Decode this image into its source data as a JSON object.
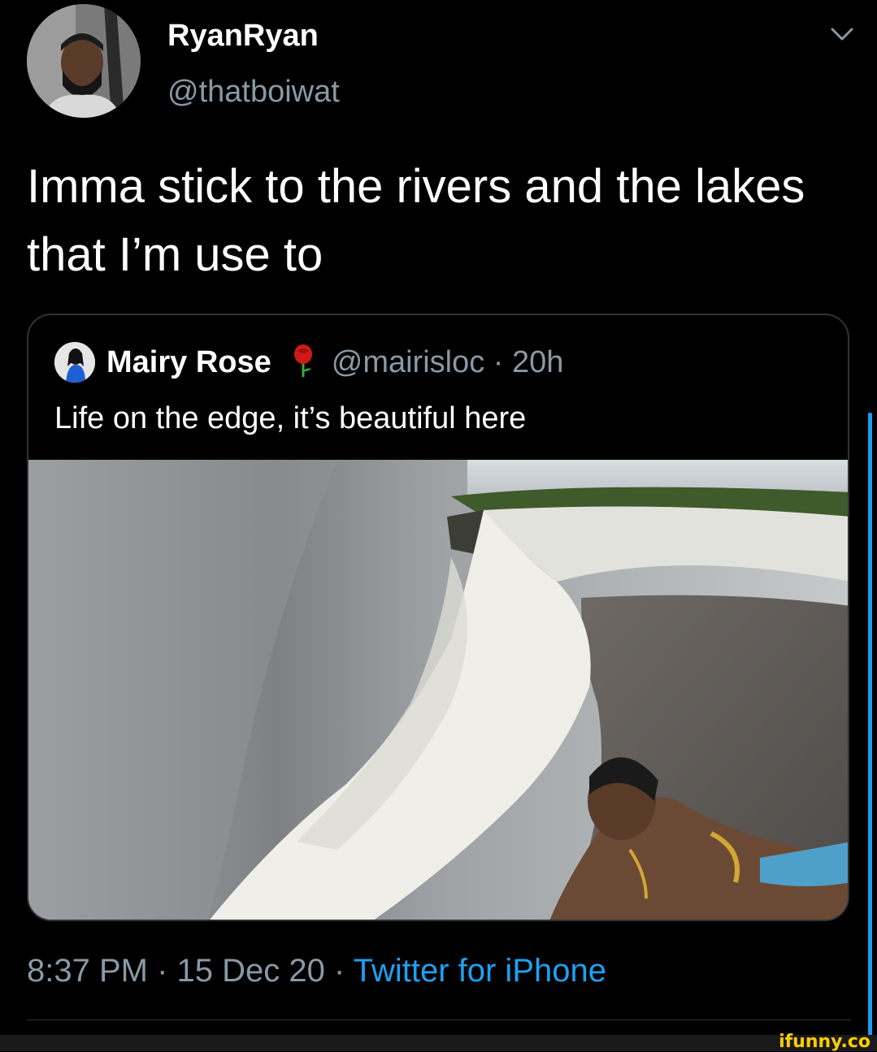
{
  "tweet": {
    "author": {
      "display_name": "RyanRyan",
      "handle": "@thatboiwat",
      "avatar_icon": "person-avatar"
    },
    "menu_icon": "chevron-down-icon",
    "text": "Imma stick to the rivers and the lakes that I’m use to",
    "quoted_tweet": {
      "author": {
        "display_name": "Mairy Rose",
        "name_emoji": "rose-icon",
        "handle": "@mairisloc",
        "separator": "·",
        "time": "20h",
        "avatar_icon": "person-avatar"
      },
      "text": "Life on the edge, it’s beautiful here",
      "media": "waterfall-photo"
    },
    "meta": {
      "time": "8:37 PM",
      "sep1": "·",
      "date": "15 Dec 20",
      "sep2": "·",
      "source": "Twitter for iPhone"
    }
  },
  "watermark": {
    "text": "ifunny.co"
  },
  "colors": {
    "background": "#000000",
    "secondary_text": "#8899a6",
    "link": "#1da1f2",
    "border": "#2f3336",
    "watermark": "#ffcc00"
  }
}
